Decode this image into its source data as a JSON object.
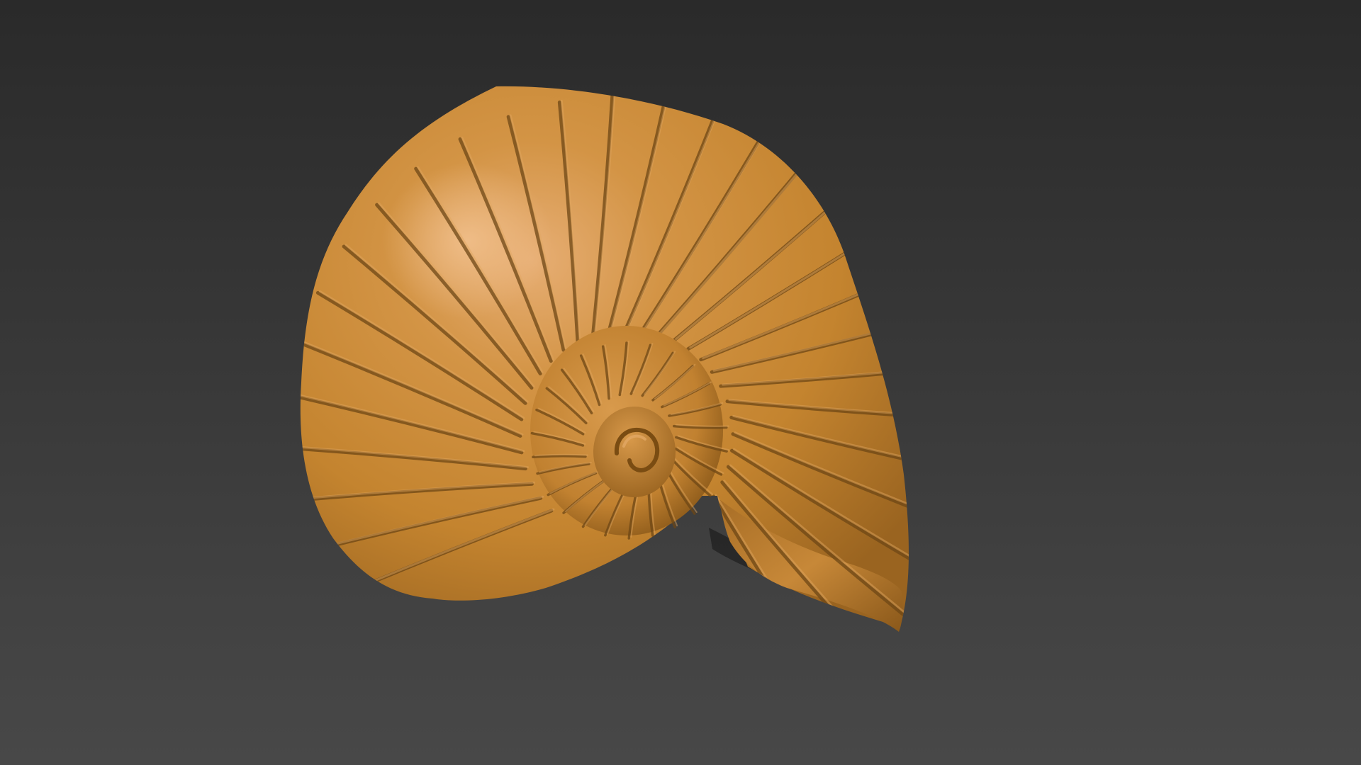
{
  "viewport": {
    "background_top": "#2a2a2a",
    "background_bottom": "#484848"
  },
  "model": {
    "type": "ammonite-shell-3d-model",
    "material_color": "#c98a3a",
    "material_highlight": "#e6ad72",
    "material_shadow": "#8a5a20",
    "rib_shadow_color": "#6e4715",
    "rib_highlight_color": "#e0a660"
  }
}
